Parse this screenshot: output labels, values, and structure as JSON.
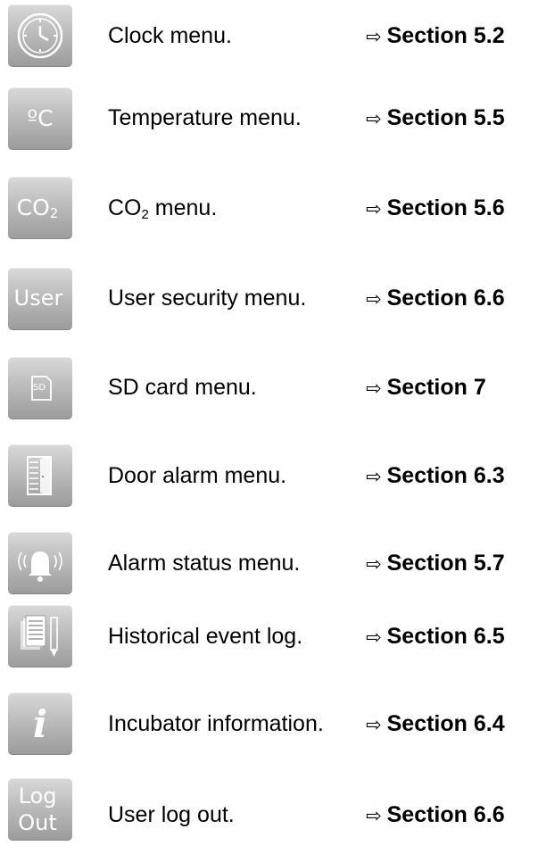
{
  "rows": [
    {
      "icon": "clock-icon",
      "label": "Clock menu.",
      "arrow": "⇨",
      "section": "Section 5.2"
    },
    {
      "icon": "temperature-icon",
      "icon_text": "ºC",
      "label": "Temperature menu.",
      "arrow": "⇨",
      "section": "Section 5.5"
    },
    {
      "icon": "co2-icon",
      "icon_text": "CO",
      "icon_sub": "2",
      "label_main": "CO",
      "label_sub": "2",
      "label_rest": " menu.",
      "arrow": "⇨",
      "section": "Section 5.6"
    },
    {
      "icon": "user-icon",
      "icon_text": "User",
      "label": "User security menu.",
      "arrow": "⇨",
      "section": "Section 6.6"
    },
    {
      "icon": "sd-card-icon",
      "icon_text": "SD",
      "label": "SD card menu.",
      "arrow": "⇨",
      "section": "Section 7"
    },
    {
      "icon": "door-icon",
      "label": "Door alarm menu.",
      "arrow": "⇨",
      "section": "Section 6.3"
    },
    {
      "icon": "alarm-bell-icon",
      "label": "Alarm status menu.",
      "arrow": "⇨",
      "section": "Section 5.7"
    },
    {
      "icon": "event-log-icon",
      "label": "Historical event log.",
      "arrow": "⇨",
      "section": "Section 6.5"
    },
    {
      "icon": "info-icon",
      "icon_text": "i",
      "label": "Incubator information.",
      "arrow": "⇨",
      "section": "Section 6.4"
    },
    {
      "icon": "logout-icon",
      "icon_text": "Log",
      "icon_text2": "Out",
      "label": "User log out.",
      "arrow": "⇨",
      "section": "Section 6.6"
    }
  ]
}
